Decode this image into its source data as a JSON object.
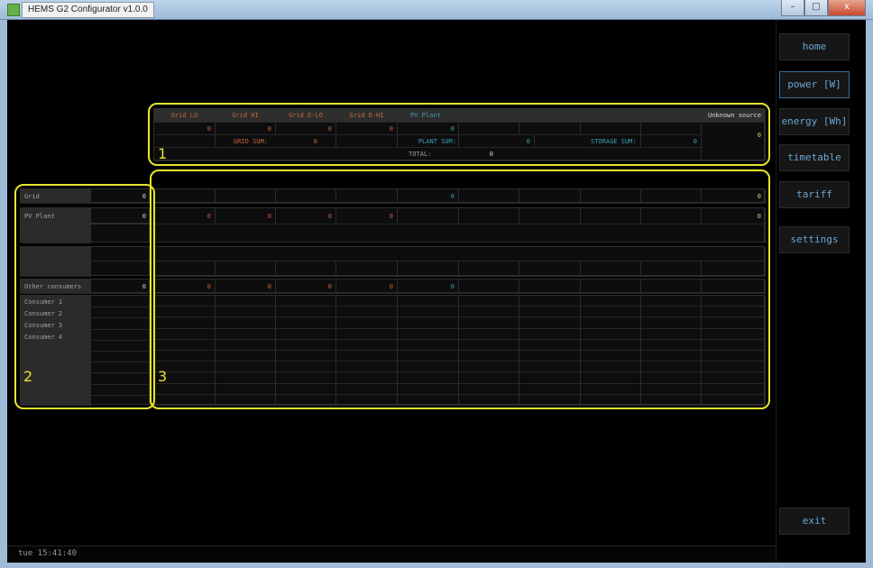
{
  "window": {
    "title": "HEMS G2 Configurator v1.0.0",
    "controls": [
      "–",
      "□",
      "x"
    ]
  },
  "nav": {
    "items": [
      {
        "label": "home",
        "active": false
      },
      {
        "label": "power [W]",
        "active": true
      },
      {
        "label": "energy [Wh]",
        "active": false
      },
      {
        "label": "timetable",
        "active": false
      },
      {
        "label": "tariff",
        "active": false
      },
      {
        "label": "settings",
        "active": false
      }
    ],
    "exit_label": "exit"
  },
  "status": {
    "time": "tue 15:41:40"
  },
  "sources": {
    "columns": [
      "Grid LO",
      "Grid HI",
      "Grid D-LO",
      "Grid D-HI",
      "PV Plant",
      "",
      "",
      "",
      "",
      "Unknown source"
    ],
    "values": [
      "0",
      "0",
      "0",
      "0",
      "0",
      "",
      "",
      "",
      "",
      "0"
    ],
    "sums": {
      "grid_label": "GRID SUM:",
      "grid_value": "0",
      "plant_label": "PLANT SUM:",
      "plant_value": "0",
      "storage_label": "STORAGE SUM:",
      "storage_value": "0",
      "total_label": "TOTAL:",
      "total_value": "0"
    }
  },
  "consumers_panel": {
    "grid_label": "Grid",
    "grid_value": "0",
    "pv_label": "PV Plant",
    "pv_value": "0",
    "other_label": "Other consumers",
    "other_value": "0",
    "consumers": [
      "Consumer 1",
      "Consumer 2",
      "Consumer 3",
      "Consumer 4"
    ]
  },
  "matrix": {
    "grid_row": [
      "",
      "",
      "",
      "",
      "0",
      "",
      "",
      "",
      "",
      "0"
    ],
    "pv_row": [
      "0",
      "0",
      "0",
      "0",
      "",
      "",
      "",
      "",
      "",
      "0"
    ],
    "other_row": [
      "0",
      "0",
      "0",
      "0",
      "0",
      "",
      "",
      "",
      "",
      ""
    ]
  },
  "callouts": [
    "1",
    "2",
    "3"
  ],
  "colors": {
    "accent_highlight": "#e6e62b",
    "grid_text": "#c4663a",
    "plant_text": "#3f9fb6",
    "nav_text": "#6aa6d4"
  }
}
